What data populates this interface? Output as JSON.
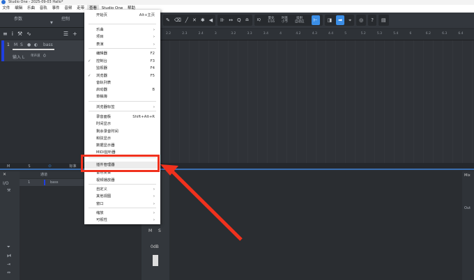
{
  "window": {
    "title": "Studio One - 2025-09-03 Hallo*"
  },
  "menubar": [
    "文件",
    "编辑",
    "乐曲",
    "音轨",
    "事件",
    "音频",
    "走带",
    "查看",
    "Studio One",
    "帮助"
  ],
  "left_panel": {
    "tab1": "参数",
    "tab2": "控制"
  },
  "track": {
    "number": "1",
    "mute": "M",
    "solo": "S",
    "name": "bass",
    "input": "输入 L",
    "mode": "单声道",
    "value": "0"
  },
  "toolbar": {
    "quantize_label": "量化",
    "quantize_value": "1/16",
    "timebase_label": "时基",
    "timebase_value": "小节",
    "snap_label": "吸附",
    "snap_value": "自适应",
    "iq": "IQ",
    "help": "?"
  },
  "ruler": [
    "2.2",
    "2.3",
    "2.4",
    "3",
    "3.2",
    "3.3",
    "3.4",
    "4",
    "4.2",
    "4.3",
    "4.4",
    "5",
    "5.2",
    "5.3",
    "5.4",
    "6",
    "6.2",
    "6.3",
    "6.4"
  ],
  "bottom_strip": {
    "m": "M",
    "s": "S",
    "mode": "标准"
  },
  "console": {
    "io": "I/O",
    "header": "通道",
    "channel_num": "1",
    "channel_name": "bass",
    "strip_m": "M",
    "strip_s": "S",
    "gain": "0dB",
    "right_label": "Mix",
    "out": "Out"
  },
  "view_menu": {
    "items": [
      {
        "label": "开始页",
        "shortcut": "Alt+主页"
      },
      {
        "label": "乐曲",
        "submenu": true
      },
      {
        "label": "项目",
        "submenu": true
      },
      {
        "label": "表演",
        "submenu": true
      },
      {
        "label": "编辑器",
        "shortcut": "F2"
      },
      {
        "label": "控制台",
        "shortcut": "F3",
        "checked": true
      },
      {
        "label": "监视器",
        "shortcut": "F4"
      },
      {
        "label": "浏览器",
        "shortcut": "F5",
        "checked": true
      },
      {
        "label": "音轨列表"
      },
      {
        "label": "启动器",
        "shortcut": "B"
      },
      {
        "label": "草稿簿"
      },
      {
        "label": "浏览器标签",
        "submenu": true
      },
      {
        "label": "录音面板",
        "shortcut": "Shift+Alt+R"
      },
      {
        "label": "时间显示"
      },
      {
        "label": "剩余录音时间"
      },
      {
        "label": "和弦显示"
      },
      {
        "label": "数据显示器"
      },
      {
        "label": "MIDI监听器"
      },
      {
        "label": "插件管理器",
        "highlighted": true
      },
      {
        "label": "音色变奏"
      },
      {
        "label": "视频播放器"
      },
      {
        "label": "自定义",
        "submenu": true
      },
      {
        "label": "其他视图",
        "submenu": true
      },
      {
        "label": "窗口",
        "submenu": true
      },
      {
        "label": "缩放",
        "submenu": true
      },
      {
        "label": "可视性",
        "submenu": true
      }
    ]
  },
  "colors": {
    "accent": "#3b8ee6",
    "annotation": "#f0311d",
    "track": "#1f3fe0"
  }
}
